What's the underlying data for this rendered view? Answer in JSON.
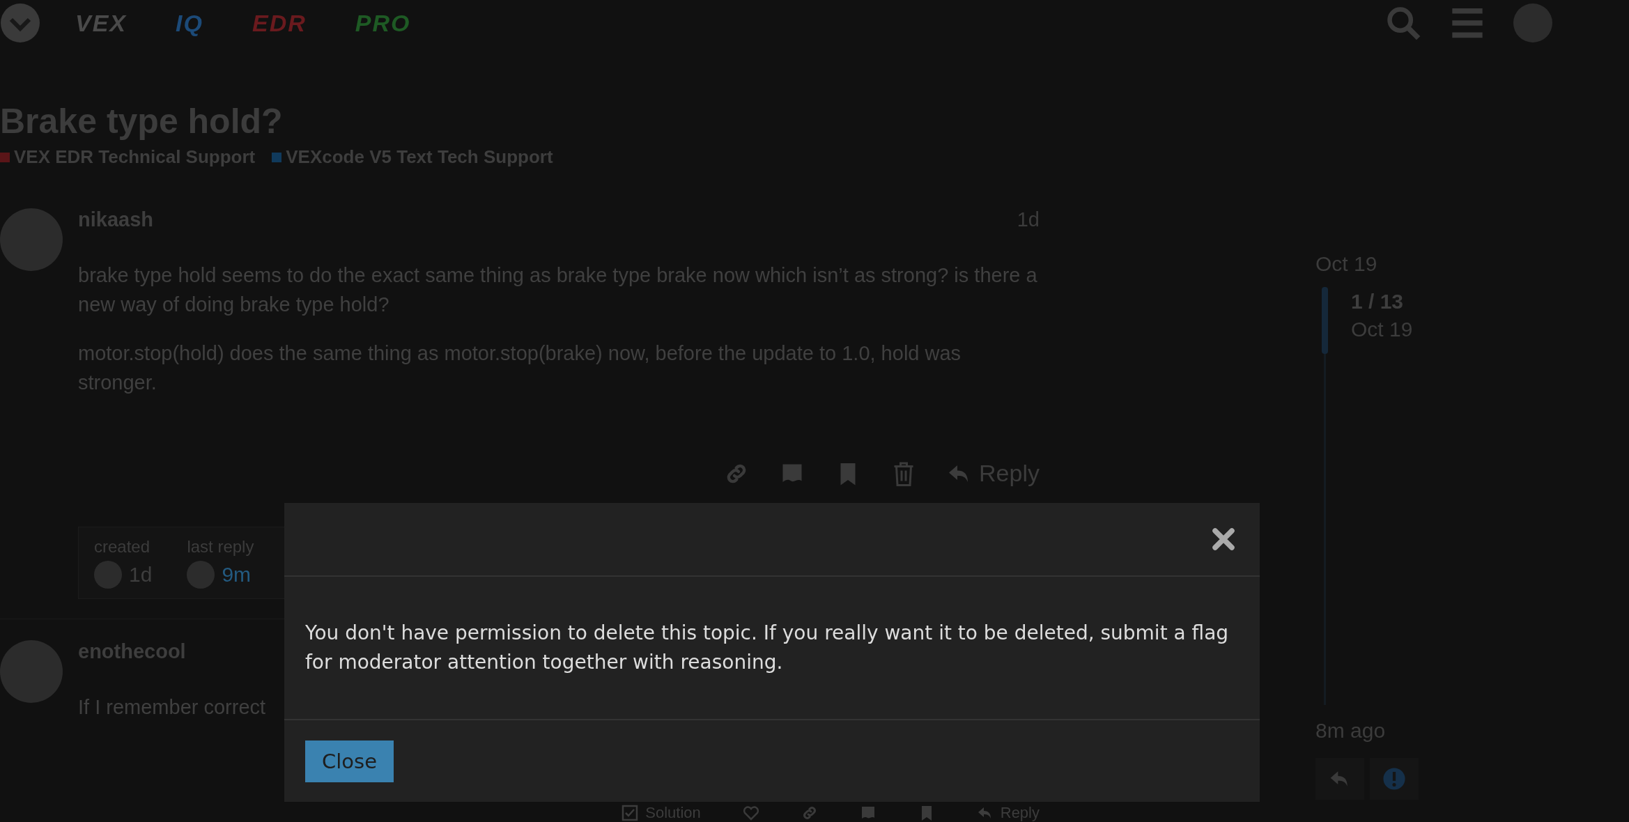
{
  "header": {
    "brand_links": [
      {
        "text": "VEX",
        "color": "#4a4a4a"
      },
      {
        "text": "IQ",
        "color": "#1c4a78"
      },
      {
        "text": "EDR",
        "color": "#6a1a1e"
      },
      {
        "text": "PRO",
        "color": "#1e5a24"
      }
    ]
  },
  "topic": {
    "title": "Brake type hold?",
    "categories": [
      {
        "name": "VEX EDR Technical Support",
        "color": "#5a1518"
      },
      {
        "name": "VEXcode V5 Text Tech Support",
        "color": "#103a5c"
      }
    ]
  },
  "posts": [
    {
      "author": "nikaash",
      "age": "1d",
      "paragraphs": [
        "brake type hold seems to do the exact same thing as brake type brake now which isn’t as strong? is there a new way of doing brake type hold?",
        "motor.stop(hold) does the same thing as motor.stop(brake) now, before the update to 1.0, hold was stronger."
      ],
      "actions": [
        {
          "kind": "link"
        },
        {
          "kind": "flag"
        },
        {
          "kind": "bookmark"
        },
        {
          "kind": "delete"
        },
        {
          "kind": "reply",
          "label": "Reply"
        }
      ],
      "topic_map": {
        "created_label": "created",
        "created_age": "1d",
        "last_reply_label": "last reply",
        "last_reply_age": "9m"
      }
    },
    {
      "author": "enothecool",
      "paragraphs": [
        "If I remember correct"
      ],
      "actions": [
        {
          "kind": "solution",
          "label": "Solution"
        },
        {
          "kind": "like"
        },
        {
          "kind": "link"
        },
        {
          "kind": "flag"
        },
        {
          "kind": "bookmark"
        },
        {
          "kind": "reply",
          "label": "Reply"
        }
      ]
    }
  ],
  "timeline": {
    "start_date": "Oct 19",
    "position": "1 / 13",
    "position_date": "Oct 19",
    "end_label": "8m ago"
  },
  "modal": {
    "message": "You don't have permission to delete this topic. If you really want it to be deleted, submit a flag for moderator attention together with reasoning.",
    "close_button": "Close"
  }
}
